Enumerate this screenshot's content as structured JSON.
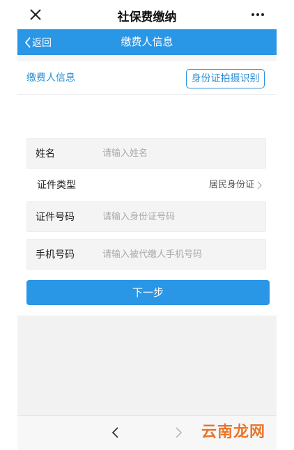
{
  "topbar": {
    "title": "社保费缴纳",
    "close_icon": "close-icon",
    "more_icon": "more-icon"
  },
  "navbar": {
    "back_label": "返回",
    "title": "缴费人信息",
    "color": "#2a96e6"
  },
  "section": {
    "title": "缴费人信息",
    "id_scan_button": "身份证拍摄识别"
  },
  "form": {
    "name": {
      "label": "姓名",
      "placeholder": "请输入姓名",
      "value": ""
    },
    "id_type": {
      "label": "证件类型",
      "value": "居民身份证"
    },
    "id_number": {
      "label": "证件号码",
      "placeholder": "请输入身份证号码",
      "value": ""
    },
    "phone": {
      "label": "手机号码",
      "placeholder": "请输入被代缴人手机号码",
      "value": ""
    }
  },
  "next_button": "下一步",
  "toolbar": {
    "back_icon": "chevron-left-icon",
    "forward_icon": "chevron-right-icon"
  },
  "watermark": "云南龙网",
  "colors": {
    "accent": "#2a96e6",
    "link": "#2a8fd6",
    "watermark": "#e8752a"
  }
}
